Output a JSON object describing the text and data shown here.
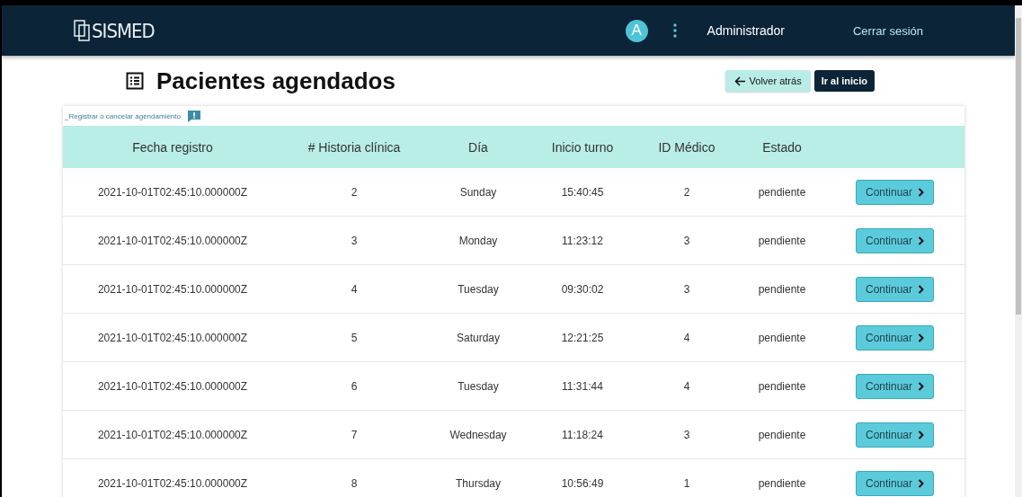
{
  "brand": "SISMED",
  "user": {
    "avatar": "A",
    "name": "Administrador",
    "logout": "Cerrar sesión"
  },
  "page_title": "Pacientes agendados",
  "buttons": {
    "back": "Volver atrás",
    "home": "Ir al inicio"
  },
  "table": {
    "caption": "_Registrar o cancelar agendamiento",
    "columns": [
      "Fecha registro",
      "# Historia clínica",
      "Día",
      "Inicio turno",
      "ID Médico",
      "Estado"
    ],
    "rows": [
      {
        "fecha": "2021-10-01T02:45:10.000000Z",
        "historia": "2",
        "dia": "Sunday",
        "inicio": "15:40:45",
        "medico": "2",
        "estado": "pendiente",
        "action": "Continuar"
      },
      {
        "fecha": "2021-10-01T02:45:10.000000Z",
        "historia": "3",
        "dia": "Monday",
        "inicio": "11:23:12",
        "medico": "3",
        "estado": "pendiente",
        "action": "Continuar"
      },
      {
        "fecha": "2021-10-01T02:45:10.000000Z",
        "historia": "4",
        "dia": "Tuesday",
        "inicio": "09:30:02",
        "medico": "3",
        "estado": "pendiente",
        "action": "Continuar"
      },
      {
        "fecha": "2021-10-01T02:45:10.000000Z",
        "historia": "5",
        "dia": "Saturday",
        "inicio": "12:21:25",
        "medico": "4",
        "estado": "pendiente",
        "action": "Continuar"
      },
      {
        "fecha": "2021-10-01T02:45:10.000000Z",
        "historia": "6",
        "dia": "Tuesday",
        "inicio": "11:31:44",
        "medico": "4",
        "estado": "pendiente",
        "action": "Continuar"
      },
      {
        "fecha": "2021-10-01T02:45:10.000000Z",
        "historia": "7",
        "dia": "Wednesday",
        "inicio": "11:18:24",
        "medico": "3",
        "estado": "pendiente",
        "action": "Continuar"
      },
      {
        "fecha": "2021-10-01T02:45:10.000000Z",
        "historia": "8",
        "dia": "Thursday",
        "inicio": "10:56:49",
        "medico": "1",
        "estado": "pendiente",
        "action": "Continuar"
      }
    ]
  }
}
